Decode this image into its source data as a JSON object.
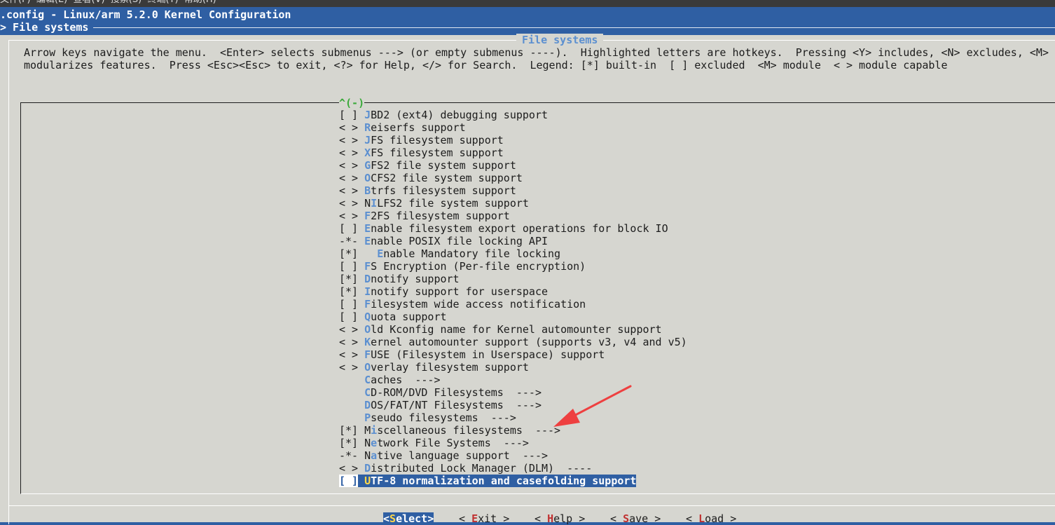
{
  "app": {
    "menubar_text": "文件(F)  编辑(E)  查看(V)  搜索(S)  终端(T)  帮助(H)",
    "title": ".config - Linux/arm 5.2.0 Kernel Configuration",
    "breadcrumb": "> File systems"
  },
  "dialog": {
    "title": "File systems",
    "help_line1": "Arrow keys navigate the menu.  <Enter> selects submenus ---> (or empty submenus ----).  Highlighted letters are hotkeys.  Pressing <Y> includes, <N> excludes, <M>",
    "help_line2": "modularizes features.  Press <Esc><Esc> to exit, <?> for Help, </> for Search.  Legend: [*] built-in  [ ] excluded  <M> module  < > module capable",
    "scroll_indicator": "^(-)"
  },
  "menu": {
    "items": [
      {
        "state": "[ ]",
        "indent": "",
        "hotkey": "J",
        "rest": "BD2 (ext4) debugging support"
      },
      {
        "state": "< >",
        "indent": "",
        "hotkey": "R",
        "rest": "eiserfs support"
      },
      {
        "state": "< >",
        "indent": "",
        "hotkey": "J",
        "rest": "FS filesystem support"
      },
      {
        "state": "< >",
        "indent": "",
        "hotkey": "X",
        "rest": "FS filesystem support"
      },
      {
        "state": "< >",
        "indent": "",
        "hotkey": "G",
        "rest": "FS2 file system support"
      },
      {
        "state": "< >",
        "indent": "",
        "hotkey": "O",
        "rest": "CFS2 file system support"
      },
      {
        "state": "< >",
        "indent": "",
        "hotkey": "B",
        "rest": "trfs filesystem support"
      },
      {
        "state": "< >",
        "indent": "",
        "pre": "N",
        "hotkey": "I",
        "rest": "LFS2 file system support"
      },
      {
        "state": "< >",
        "indent": "",
        "hotkey": "F",
        "rest": "2FS filesystem support"
      },
      {
        "state": "[ ]",
        "indent": "",
        "hotkey": "E",
        "rest": "nable filesystem export operations for block IO"
      },
      {
        "state": "-*-",
        "indent": "",
        "hotkey": "E",
        "rest": "nable POSIX file locking API"
      },
      {
        "state": "[*]",
        "indent": "  ",
        "hotkey": "E",
        "rest": "nable Mandatory file locking"
      },
      {
        "state": "[ ]",
        "indent": "",
        "hotkey": "F",
        "rest": "S Encryption (Per-file encryption)"
      },
      {
        "state": "[*]",
        "indent": "",
        "hotkey": "D",
        "rest": "notify support"
      },
      {
        "state": "[*]",
        "indent": "",
        "hotkey": "I",
        "rest": "notify support for userspace"
      },
      {
        "state": "[ ]",
        "indent": "",
        "hotkey": "F",
        "rest": "ilesystem wide access notification"
      },
      {
        "state": "[ ]",
        "indent": "",
        "hotkey": "Q",
        "rest": "uota support"
      },
      {
        "state": "< >",
        "indent": "",
        "hotkey": "O",
        "rest": "ld Kconfig name for Kernel automounter support"
      },
      {
        "state": "< >",
        "indent": "",
        "hotkey": "K",
        "rest": "ernel automounter support (supports v3, v4 and v5)"
      },
      {
        "state": "< >",
        "indent": "",
        "hotkey": "F",
        "rest": "USE (Filesystem in Userspace) support"
      },
      {
        "state": "< >",
        "indent": "",
        "hotkey": "O",
        "rest": "verlay filesystem support"
      },
      {
        "state": "   ",
        "indent": "",
        "hotkey": "C",
        "rest": "aches  --->"
      },
      {
        "state": "   ",
        "indent": "",
        "hotkey": "C",
        "rest": "D-ROM/DVD Filesystems  --->"
      },
      {
        "state": "   ",
        "indent": "",
        "hotkey": "D",
        "rest": "OS/FAT/NT Filesystems  --->"
      },
      {
        "state": "   ",
        "indent": "",
        "hotkey": "P",
        "rest": "seudo filesystems  --->"
      },
      {
        "state": "[*]",
        "indent": "",
        "pre": "M",
        "hotkey": "i",
        "rest": "scellaneous filesystems  --->"
      },
      {
        "state": "[*]",
        "indent": "",
        "pre": "N",
        "hotkey": "e",
        "rest": "twork File Systems  --->"
      },
      {
        "state": "-*-",
        "indent": "",
        "pre": "N",
        "hotkey": "a",
        "rest": "tive language support  --->"
      },
      {
        "state": "< >",
        "indent": "",
        "hotkey": "D",
        "rest": "istributed Lock Manager (DLM)  ----"
      },
      {
        "state": "[ ]",
        "indent": "",
        "hotkey": "U",
        "rest": "TF-8 normalization and casefolding support",
        "selected": true
      }
    ]
  },
  "buttons": [
    {
      "pre": "<",
      "hotkey": "S",
      "rest": "elect>",
      "active": true
    },
    {
      "pre": "< ",
      "hotkey": "E",
      "rest": "xit >",
      "active": false
    },
    {
      "pre": "< ",
      "hotkey": "H",
      "rest": "elp >",
      "active": false
    },
    {
      "pre": "< ",
      "hotkey": "S",
      "rest": "ave >",
      "active": false
    },
    {
      "pre": "< ",
      "hotkey": "L",
      "rest": "oad >",
      "active": false
    }
  ],
  "colors": {
    "terminal_blue": "#2f5fa3",
    "dialog_gray": "#d6d6d0",
    "hotkey_blue": "#5b8fd0",
    "annotation_red": "#ee4040"
  },
  "annotation": {
    "icon": "red-arrow-icon",
    "points_to": "Miscellaneous filesystems"
  }
}
